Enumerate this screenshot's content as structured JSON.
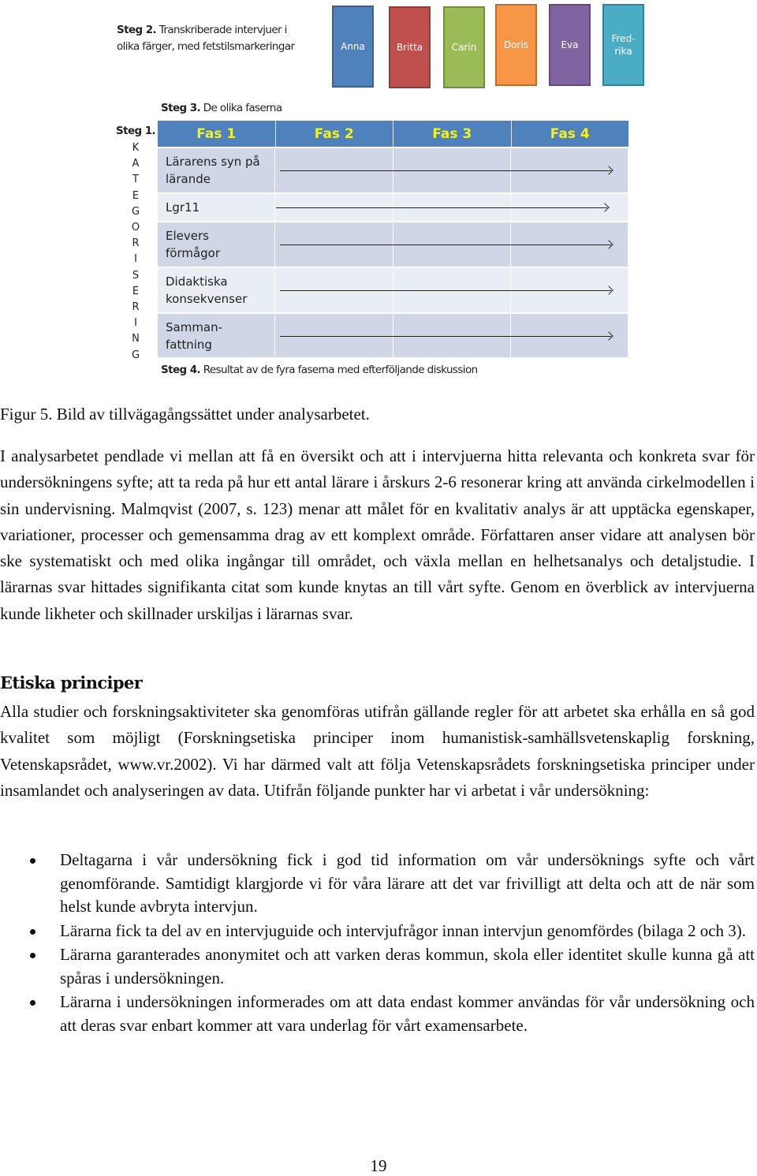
{
  "figure": {
    "steg2": {
      "label": "Steg 2.",
      "text_line1": " Transkriberade intervjuer i",
      "text_line2": "olika färger, med fetstilsmarkeringar"
    },
    "interviewees": [
      {
        "name_line1": "Anna",
        "name_line2": "",
        "color": "#4f81bd"
      },
      {
        "name_line1": "Britta",
        "name_line2": "",
        "color": "#c0504d"
      },
      {
        "name_line1": "Carin",
        "name_line2": "",
        "color": "#9bbb59"
      },
      {
        "name_line1": "Doris",
        "name_line2": "",
        "color": "#f79646"
      },
      {
        "name_line1": "Eva",
        "name_line2": "",
        "color": "#8064a2"
      },
      {
        "name_line1": "Fred-",
        "name_line2": "rika",
        "color": "#4bacc6"
      }
    ],
    "steg3": {
      "label": "Steg 3.",
      "text": " De olika faserna"
    },
    "steg1": {
      "label": "Steg 1.",
      "vertical_letters": [
        "K",
        "A",
        "T",
        "E",
        "G",
        "O",
        "R",
        "I",
        "S",
        "E",
        "R",
        "I",
        "N",
        "G"
      ]
    },
    "phases": [
      "Fas 1",
      "Fas 2",
      "Fas 3",
      "Fas 4"
    ],
    "categories": [
      {
        "line1": "Lärarens syn på",
        "line2": "lärande"
      },
      {
        "line1": "Lgr11",
        "line2": ""
      },
      {
        "line1": "Elevers",
        "line2": "förmågor"
      },
      {
        "line1": "Didaktiska",
        "line2": "konsekvenser"
      },
      {
        "line1": "Samman-",
        "line2": "fattning"
      }
    ],
    "steg4": {
      "label": "Steg 4.",
      "text": " Resultat av de fyra faserna med efterföljande diskussion"
    },
    "colors": {
      "header_bg": "#4f81bd",
      "header_text": "#f2f21e",
      "row_dark": "#cfd7e6",
      "row_light": "#e9edf4"
    }
  },
  "caption": "Figur 5. Bild av tillvägagångssättet under analysarbetet.",
  "paragraph1": "I analysarbetet pendlade vi mellan att få en översikt och att i intervjuerna hitta relevanta och konkreta svar för undersökningens syfte; att ta reda på hur ett antal lärare i årskurs 2-6 resonerar kring att använda cirkelmodellen i sin undervisning. Malmqvist (2007, s. 123) menar att målet för en kvalitativ analys är att upptäcka egenskaper, variationer, processer och gemensamma drag av ett komplext område. Författaren anser vidare att analysen bör ske systematiskt och med olika ingångar till området, och växla mellan en helhetsanalys och detaljstudie. I lärarnas svar hittades signifikanta citat som kunde knytas an till vårt syfte. Genom en överblick av intervjuerna kunde likheter och skillnader urskiljas i lärarnas svar.",
  "heading": "Etiska principer",
  "paragraph2": "Alla studier och forskningsaktiviteter ska genomföras utifrån gällande regler för att arbetet ska erhålla en så god kvalitet som möjligt (Forskningsetiska principer inom humanistisk-samhällsvetenskaplig forskning, Vetenskapsrådet, www.vr.2002). Vi har därmed valt att följa Vetenskapsrådets forskningsetiska principer under insamlandet och analyseringen av data. Utifrån följande punkter har vi arbetat i vår undersökning:",
  "bullets": [
    "Deltagarna i vår undersökning fick i god tid information om vår undersöknings syfte och vårt genomförande. Samtidigt klargjorde vi för våra lärare att det var frivilligt att delta och att de när som helst kunde avbryta intervjun.",
    "Lärarna fick ta del av en intervjuguide och intervjufrågor innan intervjun genomfördes (bilaga 2 och 3).",
    "Lärarna garanterades anonymitet och att varken deras kommun, skola eller identitet skulle kunna gå att spåras i undersökningen.",
    "Lärarna i undersökningen informerades om att data endast kommer användas för vår undersökning och att deras svar enbart kommer att vara underlag för vårt examensarbete."
  ],
  "page_number": "19"
}
